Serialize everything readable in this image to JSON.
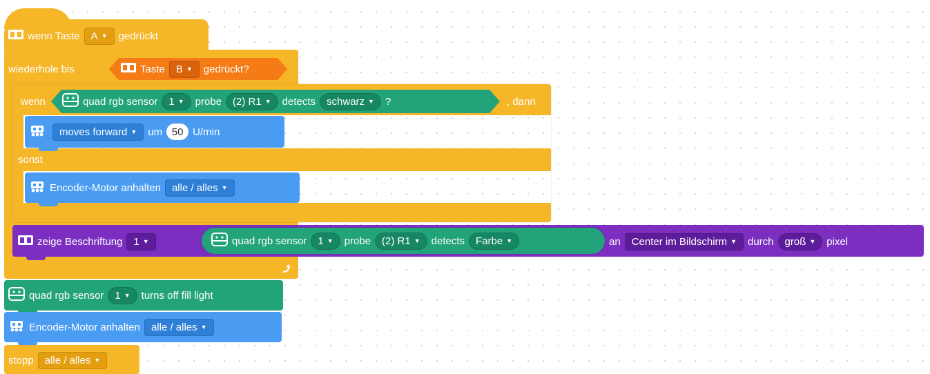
{
  "hat": {
    "prefix": "wenn Taste",
    "key": "A",
    "suffix": "gedrückt"
  },
  "repeat_until": {
    "label": "wiederhole bis",
    "condition": {
      "prefix": "Taste",
      "key": "B",
      "suffix": "gedrückt?"
    }
  },
  "if_block": {
    "if_label": "wenn",
    "sensor_label": "quad rgb sensor",
    "sensor_index": "1",
    "probe_label": "probe",
    "probe_value": "(2) R1",
    "detects_label": "detects",
    "color_value": "schwarz",
    "question": "?",
    "then_label": ", dann",
    "else_label": "sonst"
  },
  "move_block": {
    "direction": "moves forward",
    "um_label": "um",
    "speed": "50",
    "unit": "U/min"
  },
  "stop_encoder_inner": {
    "label": "Encoder-Motor anhalten",
    "value": "alle / alles"
  },
  "show_label_block": {
    "label": "zeige Beschriftung",
    "index": "1",
    "sensor_label": "quad rgb sensor",
    "sensor_index": "1",
    "probe_label": "probe",
    "probe_value": "(2) R1",
    "detects_label": "detects",
    "detects_value": "Farbe",
    "an_label": "an",
    "position_value": "Center im Bildschirm",
    "durch_label": "durch",
    "size_value": "groß",
    "pixel_label": "pixel"
  },
  "fill_light_block": {
    "sensor_label": "quad rgb sensor",
    "sensor_index": "1",
    "suffix": "turns off fill light"
  },
  "stop_encoder_outer": {
    "label": "Encoder-Motor anhalten",
    "value": "alle / alles"
  },
  "stop_block": {
    "label": "stopp",
    "value": "alle / alles"
  },
  "colors": {
    "events": "#f5b627",
    "control": "#f5b627",
    "sensing_orange": "#f47b16",
    "sensor_green": "#22a37a",
    "motor_blue": "#4a9cf3",
    "display_purple": "#7b2ec0"
  },
  "icons": {
    "board": "board-icon",
    "sensor": "quad-rgb-sensor-icon",
    "motor": "encoder-motor-icon",
    "loop": "loop-arrow-icon"
  }
}
